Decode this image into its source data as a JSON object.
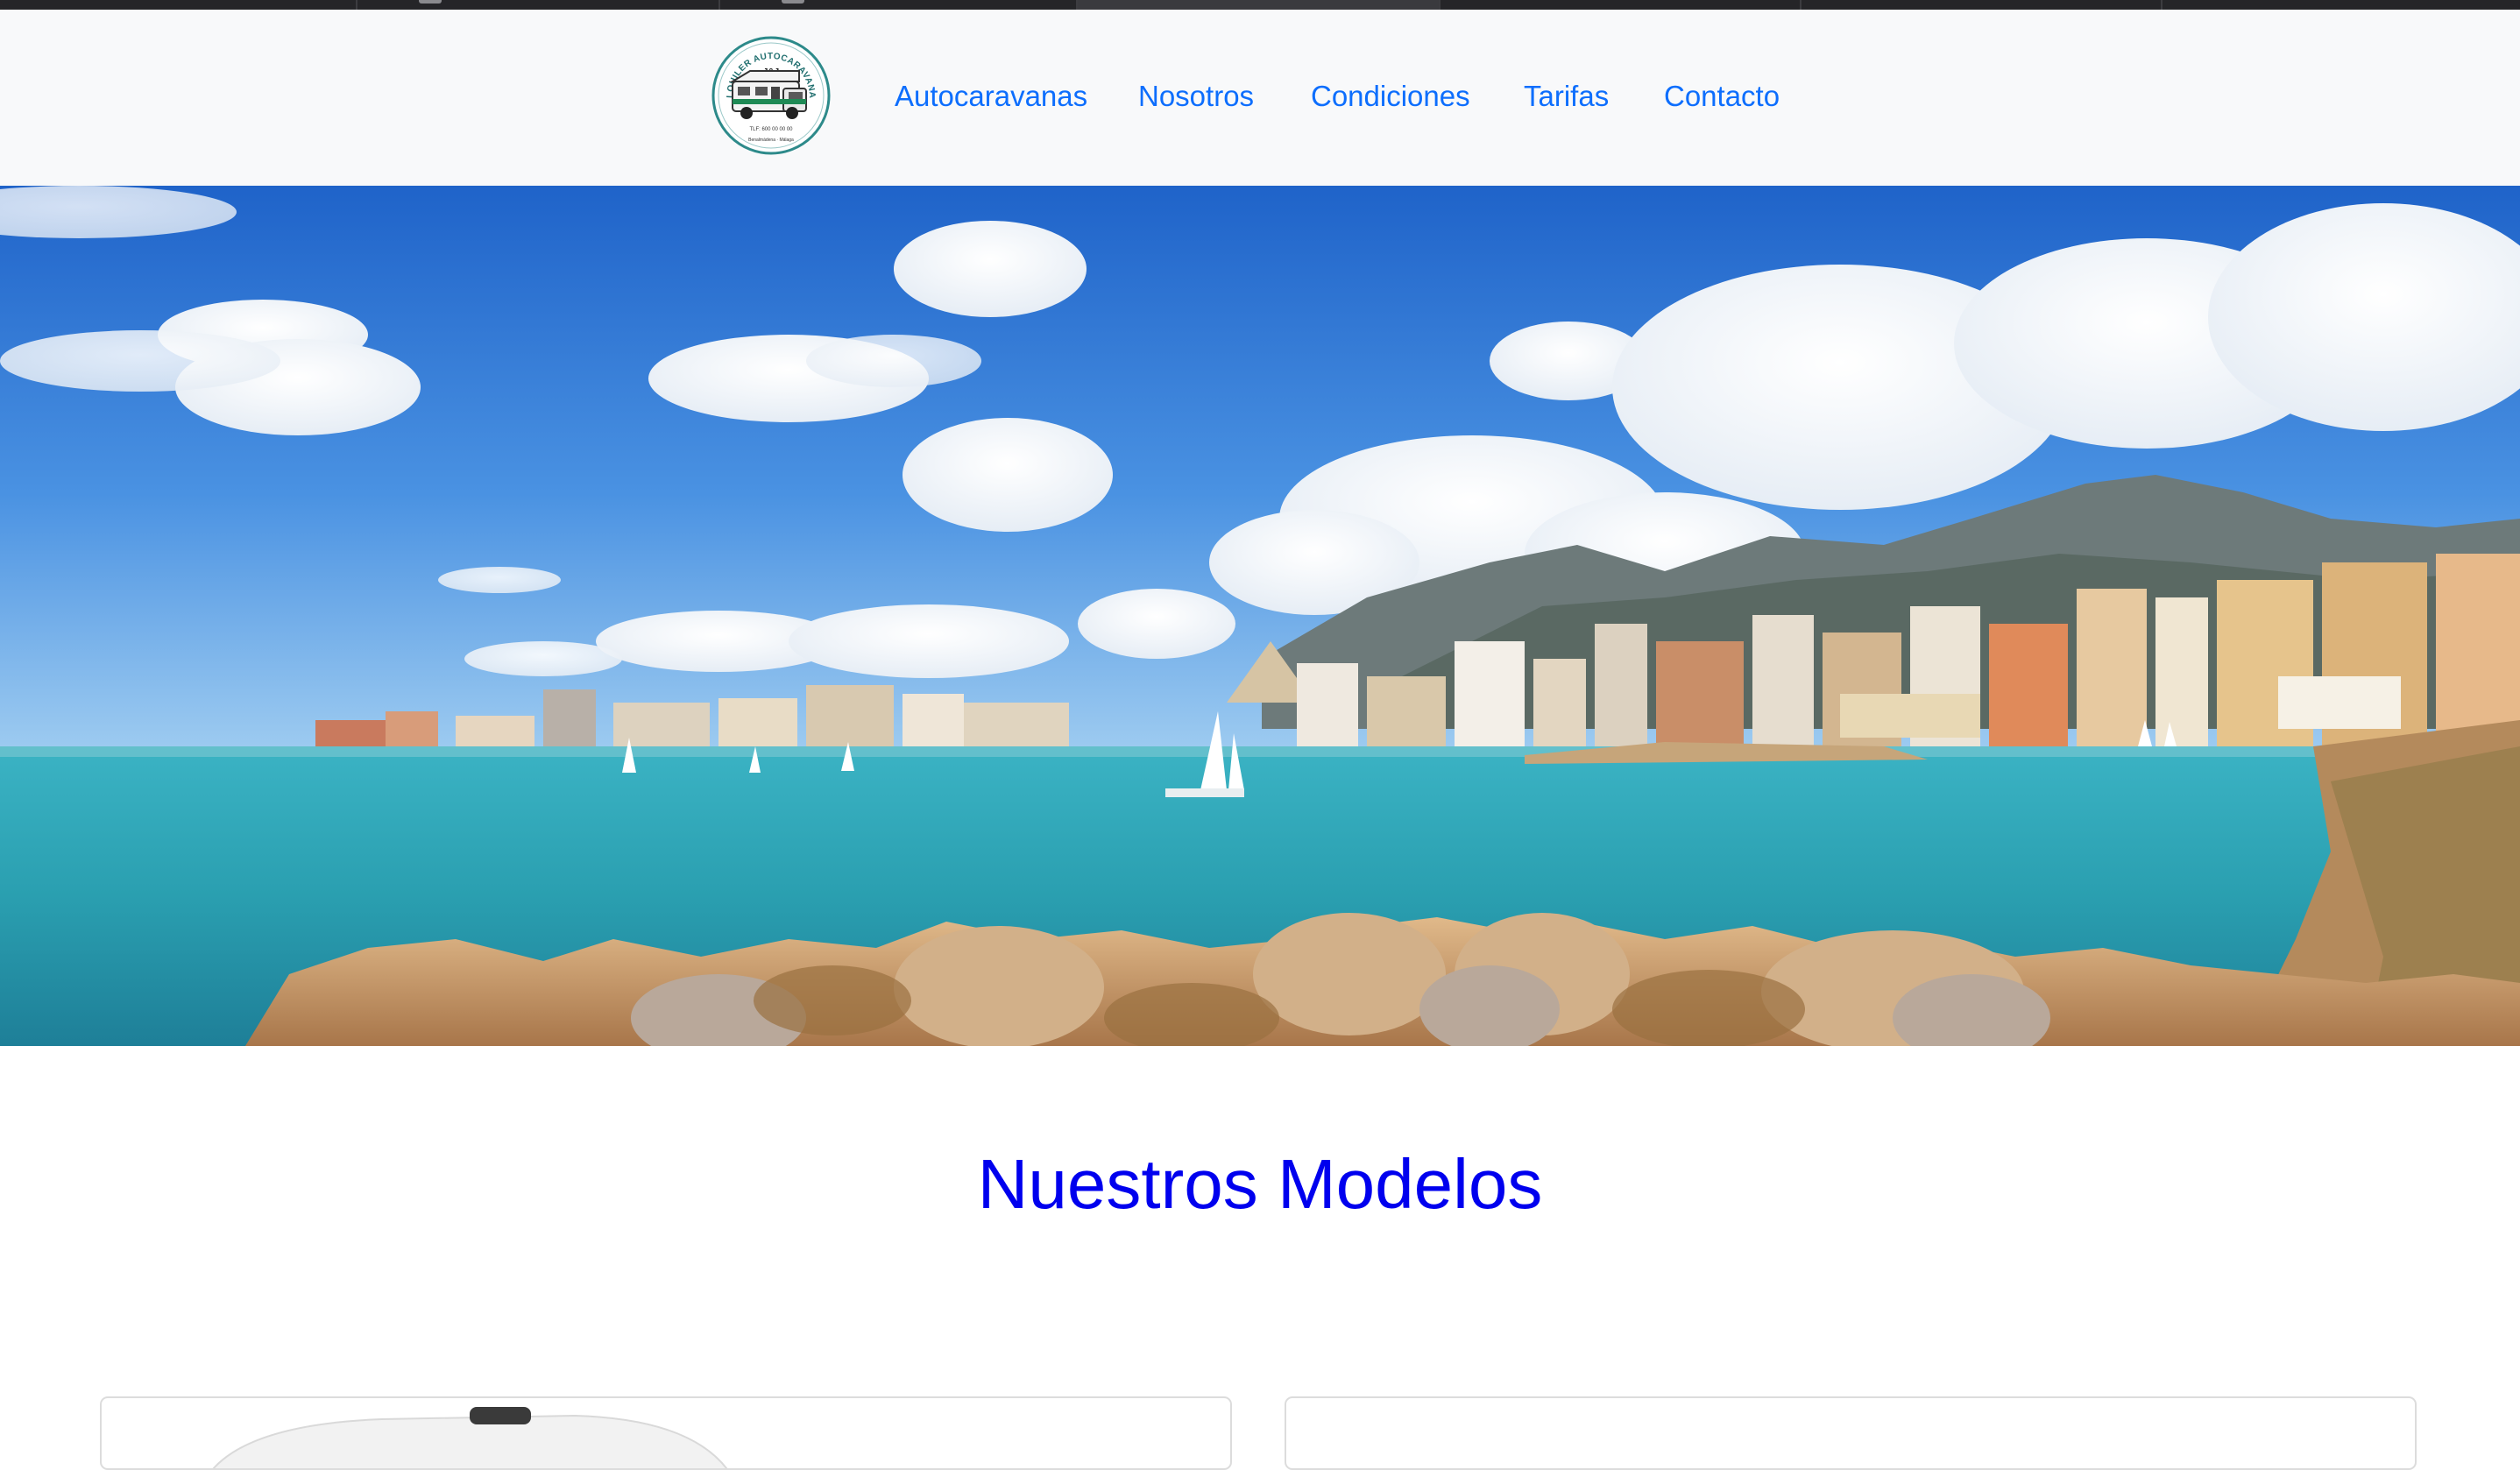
{
  "browser": {
    "tabs": 7,
    "active_tab": 3
  },
  "navbar": {
    "logo": {
      "ring_text": "ALQUILER AUTOCARAVANAS",
      "center_text": "J&J",
      "phone_text": "TLF: 600 00 00 00",
      "bottom_text": "Benalmádena · Málaga"
    },
    "links": [
      {
        "label": "Autocaravanas"
      },
      {
        "label": "Nosotros"
      },
      {
        "label": "Condiciones"
      },
      {
        "label": "Tarifas"
      },
      {
        "label": "Contacto"
      }
    ]
  },
  "hero": {
    "image": "Benalmádena coastline with marina, sailboats, rocks and mountains"
  },
  "main": {
    "title": "Nuestros Modelos"
  },
  "colors": {
    "link": "#0d6efd",
    "title": "#0000ee",
    "navbar_bg": "#f8f9fa",
    "tabstrip": "#252528"
  }
}
